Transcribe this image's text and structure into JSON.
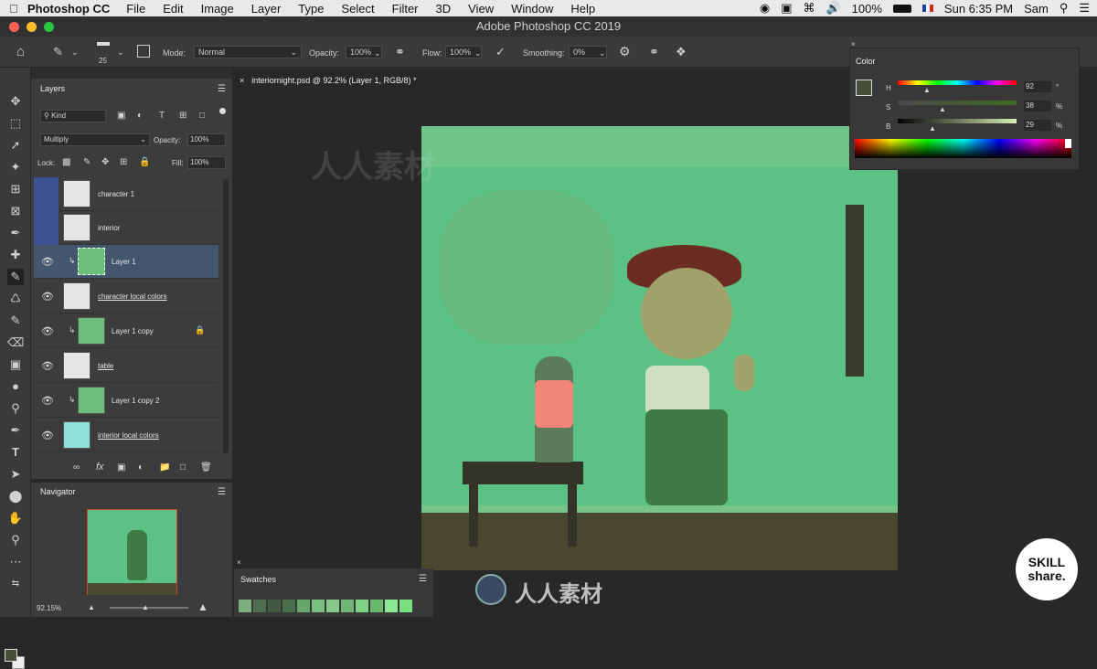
{
  "menubar": {
    "app": "Photoshop CC",
    "items": [
      "File",
      "Edit",
      "Image",
      "Layer",
      "Type",
      "Select",
      "Filter",
      "3D",
      "View",
      "Window",
      "Help"
    ],
    "battery": "100%",
    "clock": "Sun 6:35 PM",
    "user": "Sam"
  },
  "window_title": "Adobe Photoshop CC 2019",
  "options": {
    "brush_size": "25",
    "mode_label": "Mode:",
    "mode_value": "Normal",
    "opacity_label": "Opacity:",
    "opacity_value": "100%",
    "flow_label": "Flow:",
    "flow_value": "100%",
    "smoothing_label": "Smoothing:",
    "smoothing_value": "0%"
  },
  "document_tab": "interiornight.psd @ 92.2% (Layer 1, RGB/8) *",
  "layers_panel": {
    "title": "Layers",
    "filter_kind": "Kind",
    "blend_mode": "Multiply",
    "opacity_label": "Opacity:",
    "opacity_value": "100%",
    "lock_label": "Lock:",
    "fill_label": "Fill:",
    "fill_value": "100%",
    "layers": [
      {
        "name": "character 1"
      },
      {
        "name": "interior"
      },
      {
        "name": "Layer 1"
      },
      {
        "name": "character local colors"
      },
      {
        "name": "Layer 1 copy"
      },
      {
        "name": "table"
      },
      {
        "name": "Layer 1 copy 2"
      },
      {
        "name": "interior local colors"
      }
    ]
  },
  "navigator": {
    "title": "Navigator",
    "zoom": "92.15%"
  },
  "color_panel": {
    "title": "Color",
    "h_label": "H",
    "h_value": "92",
    "h_unit": "°",
    "s_label": "S",
    "s_value": "38",
    "s_unit": "%",
    "b_label": "B",
    "b_value": "29",
    "b_unit": "%"
  },
  "swatches_panel": {
    "title": "Swatches",
    "colors": [
      "#7cae80",
      "#4e6e4e",
      "#3f5a40",
      "#4a704b",
      "#66a86b",
      "#79bf7f",
      "#86c98a",
      "#6fb574",
      "#7fd184",
      "#67b86d",
      "#8de893",
      "#79df80"
    ]
  },
  "watermark": {
    "brand": "SKILL share.",
    "site_text": "人人素材"
  },
  "colors": {
    "canvas_green": "#5bc184",
    "accent_blue": "#2d6bbf",
    "selected_row": "#44566e"
  }
}
